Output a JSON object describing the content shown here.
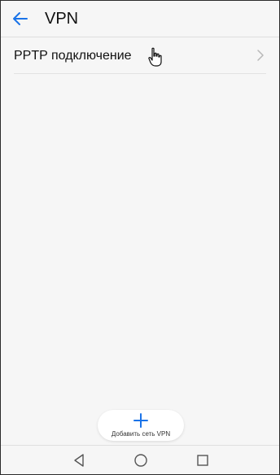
{
  "header": {
    "back_icon": "arrow-left-icon",
    "title": "VPN",
    "accent_color": "#1a73e8"
  },
  "list": {
    "items": [
      {
        "label": "PPTP подключение",
        "icon": "chevron-right-icon"
      }
    ]
  },
  "fab": {
    "icon": "plus-icon",
    "label": "Добавить сеть VPN"
  },
  "nav_bar": {
    "back_icon": "triangle-back-icon",
    "home_icon": "circle-home-icon",
    "recents_icon": "square-recents-icon"
  }
}
